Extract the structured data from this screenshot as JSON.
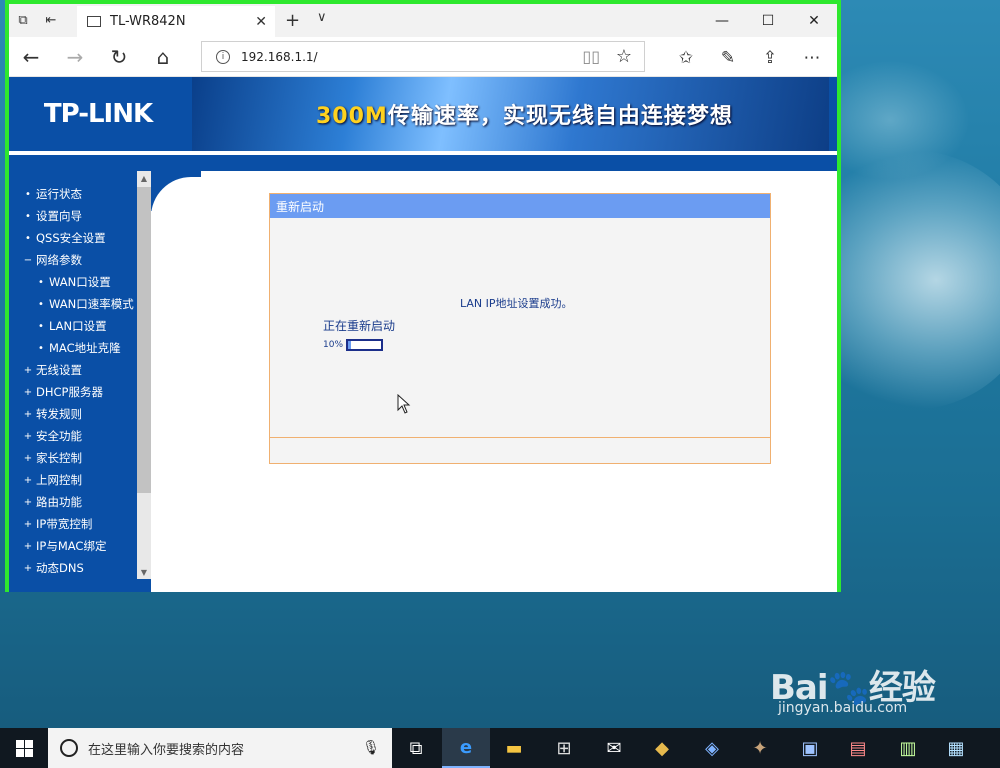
{
  "browser": {
    "tab_title": "TL-WR842N",
    "url": "192.168.1.1/"
  },
  "router": {
    "logo": "TP-LINK",
    "banner_highlight": "300M",
    "banner_text": "传输速率，实现无线自由连接梦想",
    "menu": [
      {
        "label": "运行状态",
        "bullet": "•",
        "sub": false
      },
      {
        "label": "设置向导",
        "bullet": "•",
        "sub": false
      },
      {
        "label": "QSS安全设置",
        "bullet": "•",
        "sub": false
      },
      {
        "label": "网络参数",
        "bullet": "−",
        "sub": false
      },
      {
        "label": "WAN口设置",
        "bullet": "•",
        "sub": true
      },
      {
        "label": "WAN口速率模式",
        "bullet": "•",
        "sub": true
      },
      {
        "label": "LAN口设置",
        "bullet": "•",
        "sub": true
      },
      {
        "label": "MAC地址克隆",
        "bullet": "•",
        "sub": true
      },
      {
        "label": "无线设置",
        "bullet": "+",
        "sub": false
      },
      {
        "label": "DHCP服务器",
        "bullet": "+",
        "sub": false
      },
      {
        "label": "转发规则",
        "bullet": "+",
        "sub": false
      },
      {
        "label": "安全功能",
        "bullet": "+",
        "sub": false
      },
      {
        "label": "家长控制",
        "bullet": "+",
        "sub": false
      },
      {
        "label": "上网控制",
        "bullet": "+",
        "sub": false
      },
      {
        "label": "路由功能",
        "bullet": "+",
        "sub": false
      },
      {
        "label": "IP带宽控制",
        "bullet": "+",
        "sub": false
      },
      {
        "label": "IP与MAC绑定",
        "bullet": "+",
        "sub": false
      },
      {
        "label": "动态DNS",
        "bullet": "+",
        "sub": false
      }
    ],
    "panel": {
      "title": "重新启动",
      "message": "LAN IP地址设置成功。",
      "status": "正在重新启动",
      "progress_label": "10%",
      "progress_value": 0.1
    }
  },
  "taskbar": {
    "search_placeholder": "在这里输入你要搜索的内容"
  },
  "watermark": {
    "main": "Bai🐾经验",
    "sub": "jingyan.baidu.com"
  },
  "colors": {
    "window_border": "#2ee82e",
    "router_blue": "#0a4fa6",
    "panel_header": "#6b9cf2",
    "panel_border": "#f0b070"
  }
}
